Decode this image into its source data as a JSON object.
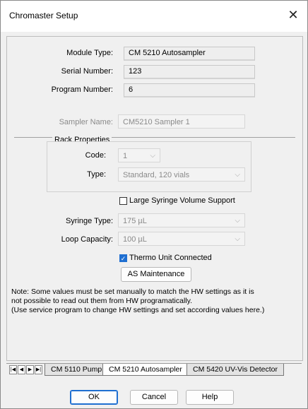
{
  "window": {
    "title": "Chromaster Setup",
    "close_glyph": "✕"
  },
  "module": {
    "module_type_label": "Module Type:",
    "module_type_value": "CM 5210 Autosampler",
    "serial_number_label": "Serial Number:",
    "serial_number_value": "123",
    "program_number_label": "Program Number:",
    "program_number_value": "6"
  },
  "sampler": {
    "name_label": "Sampler Name:",
    "name_value": "CM5210 Sampler 1"
  },
  "rack": {
    "group_title": "Rack Properties",
    "code_label": "Code:",
    "code_value": "1",
    "type_label": "Type:",
    "type_value": "Standard, 120 vials"
  },
  "options": {
    "large_syringe_label": "Large Syringe Volume Support",
    "large_syringe_checked": false,
    "syringe_type_label": "Syringe Type:",
    "syringe_type_value": "175 µL",
    "loop_capacity_label": "Loop Capacity:",
    "loop_capacity_value": "100 µL",
    "thermo_unit_label": "Thermo Unit Connected",
    "thermo_unit_checked": true,
    "as_maintenance_label": "AS Maintenance"
  },
  "note": {
    "line1": "Note: Some values must be set manually to match the HW settings as it is",
    "line2": "not possible to read out them from HW programatically.",
    "line3": "(Use service program to change HW settings and set according values here.)"
  },
  "tabs": [
    {
      "label": "CM 5110 Pump",
      "active": false
    },
    {
      "label": "CM 5210 Autosampler",
      "active": true
    },
    {
      "label": "CM 5420 UV-Vis Detector",
      "active": false
    }
  ],
  "buttons": {
    "ok": "OK",
    "cancel": "Cancel",
    "help": "Help"
  },
  "icons": {
    "checkmark": "✓",
    "dropdown_chevron": "⌵",
    "nav_first": "|◀",
    "nav_prev": "◀",
    "nav_next": "▶",
    "nav_last": "▶|"
  }
}
